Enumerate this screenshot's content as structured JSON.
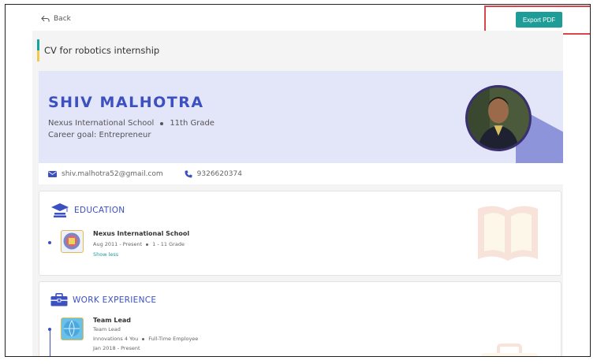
{
  "nav": {
    "back_label": "Back",
    "export_label": "Export PDF"
  },
  "cv": {
    "title": "CV for robotics internship"
  },
  "profile": {
    "name": "SHIV MALHOTRA",
    "school": "Nexus International School",
    "grade": "11th Grade",
    "career_goal": "Career goal: Entrepreneur",
    "email": "shiv.malhotra52@gmail.com",
    "phone": "9326620374"
  },
  "sections": {
    "education": {
      "title": "EDUCATION",
      "entries": [
        {
          "name": "Nexus International School",
          "period": "Aug 2011 - Present",
          "grade": "1 - 11 Grade",
          "toggle": "Show less"
        }
      ]
    },
    "work": {
      "title": "WORK EXPERIENCE",
      "entries": [
        {
          "role": "Team Lead",
          "role_sub": "Team Lead",
          "org": "Innovations 4 You",
          "type": "Full-Time Employee",
          "period": "Jan 2018 - Present"
        }
      ]
    }
  },
  "colors": {
    "accent": "#1e9c98",
    "brand": "#3c50c0",
    "highlight": "#d9454a"
  }
}
